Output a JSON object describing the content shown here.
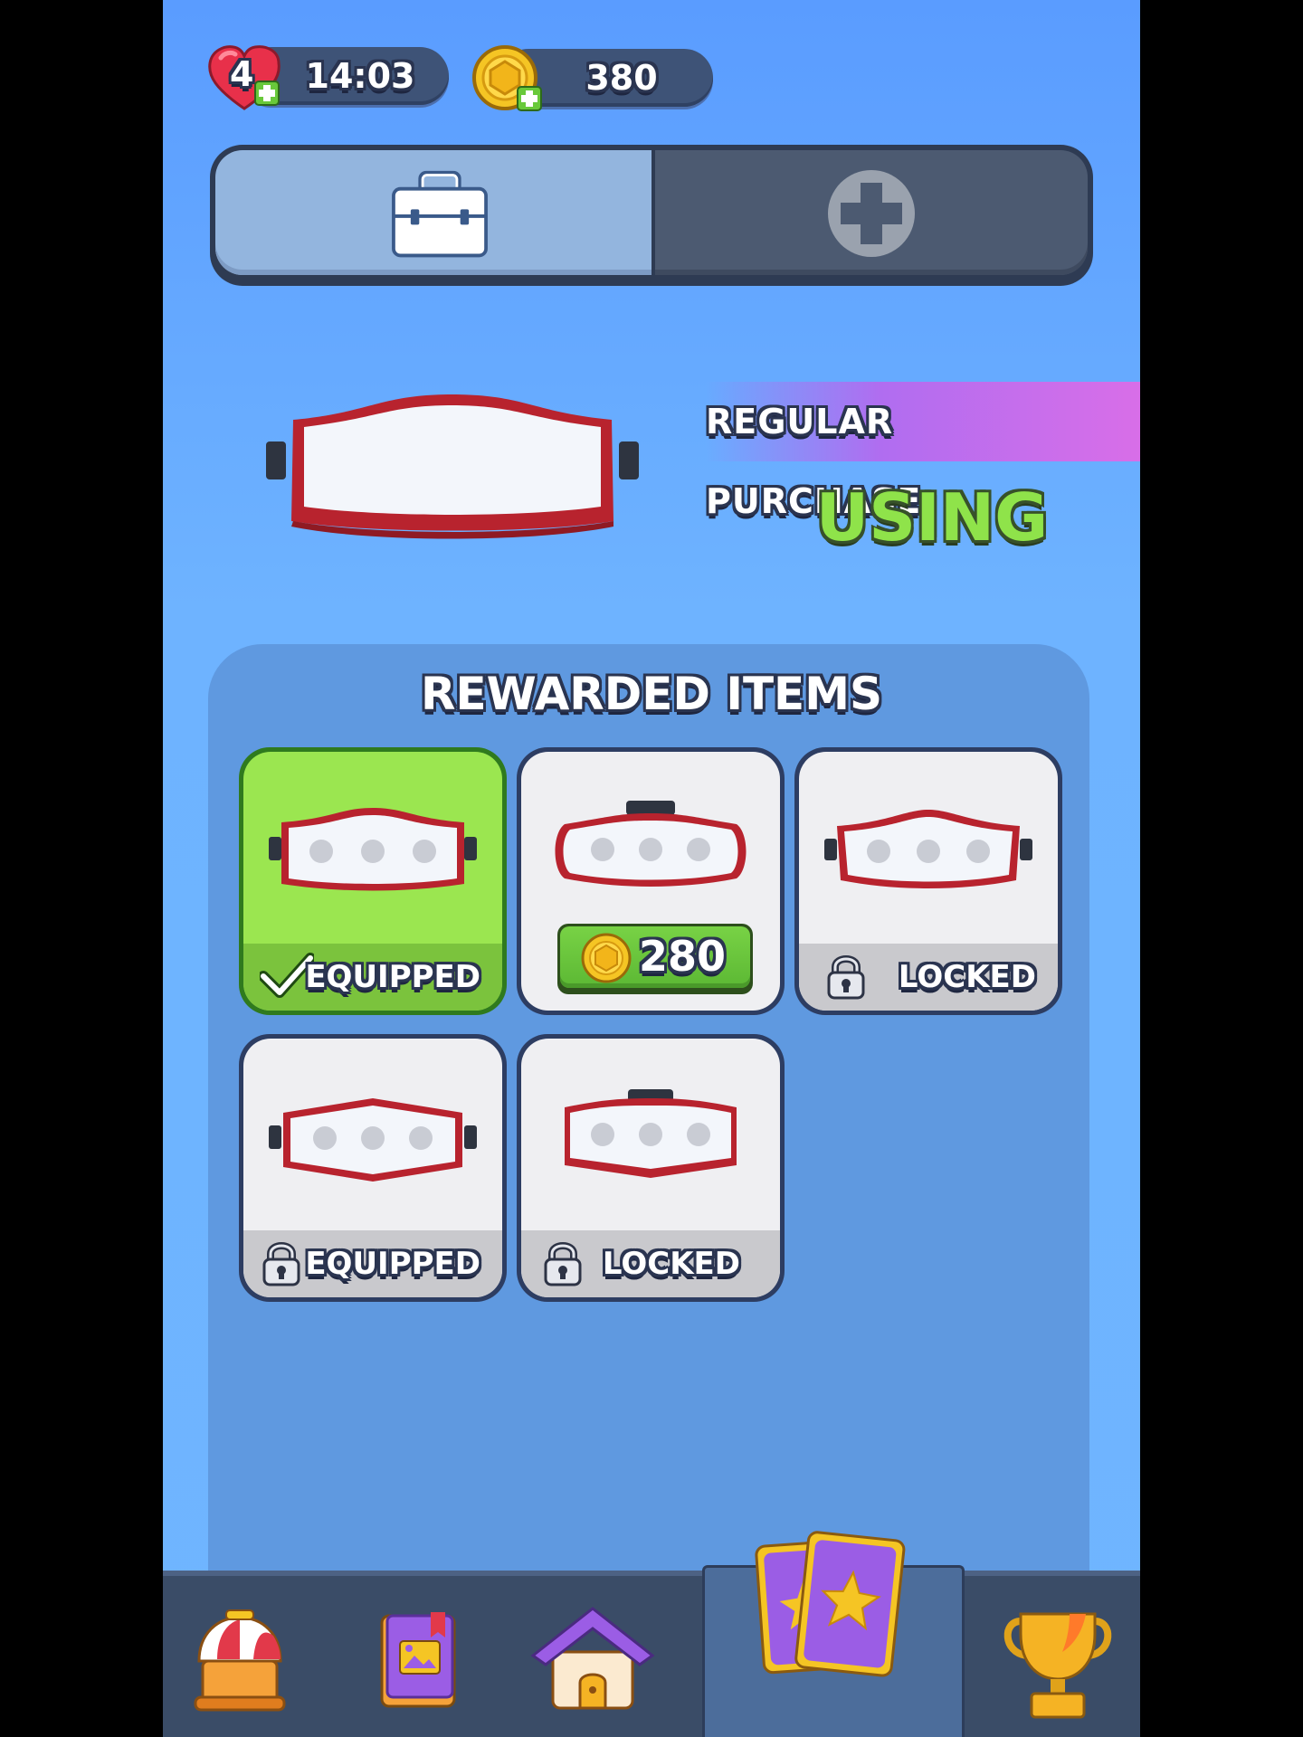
{
  "status": {
    "lives": "4",
    "timer": "14:03",
    "coins": "380"
  },
  "tabs": [
    {
      "name": "toolbox",
      "selected": true
    },
    {
      "name": "add",
      "selected": false
    }
  ],
  "preview": {
    "badge": "REGULAR PURCHASE",
    "state": "USING"
  },
  "rewards": {
    "title": "REWARDED ITEMS",
    "items": [
      {
        "status": "EQUIPPED",
        "style": "selected"
      },
      {
        "price": "280",
        "style": "buy"
      },
      {
        "status": "LOCKED",
        "style": "locked"
      },
      {
        "status": "EQUIPPED",
        "style": "locked"
      },
      {
        "status": "LOCKED",
        "style": "locked"
      }
    ]
  },
  "nav": {
    "items": [
      "shop-icon",
      "album-icon",
      "home-icon",
      "cards-icon",
      "trophy-icon"
    ],
    "selected": "cards-icon"
  },
  "colors": {
    "background": "#6eb3ff",
    "panel": "#5f99e0",
    "equipped_green": "#9be650",
    "using_text": "#8fe34a",
    "ribbon": "#d86ee8"
  }
}
